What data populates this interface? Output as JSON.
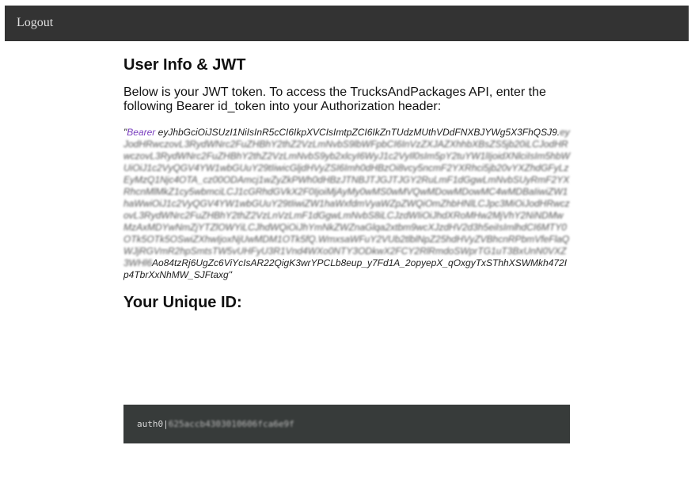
{
  "nav": {
    "logout_label": "Logout"
  },
  "main": {
    "title": "User Info & JWT",
    "intro": "Below is your JWT token. To access the TrucksAndPackages API, enter the following Bearer id_token into your Authorization header:",
    "token": {
      "open_quote": "\"",
      "bearer": "Bearer",
      "first_line": "eyJhbGciOiJSUzI1NiIsInR5cCI6IkpXVCIsImtpZCI6IkZnTUdzMUthVDdFNXBJYWg5X3FhQSJ9.",
      "obscured": "eyJodHRwczovL3RydWNrc2FuZHBhY2thZ2VzLmNvbS9lbWFpbCI6InVzZXJAZXhhbXBsZS5jb20iLCJodHRwczovL3RydWNrc2FuZHBhY2thZ2VzLmNvbS9yb2xlcyI6WyJ1c2VyIl0sIm5pY2tuYW1lIjoidXNlciIsIm5hbWUiOiJ1c2VyQGV4YW1wbGUuY29tIiwicGljdHVyZSI6Imh0dHBzOi8vcy5ncmF2YXRhci5jb20vYXZhdGFyLzEyMzQ1Njc4OTA_cz00ODAmcj1wZyZkPWh0dHBzJTNBJTJGJTJGY2RuLmF1dGgwLmNvbSUyRmF2YXRhcnMlMkZ1cy5wbmciLCJ1cGRhdGVkX2F0IjoiMjAyMy0wMS0wMVQwMDowMDowMC4wMDBaIiwiZW1haWwiOiJ1c2VyQGV4YW1wbGUuY29tIiwiZW1haWxfdmVyaWZpZWQiOmZhbHNlLCJpc3MiOiJodHRwczovL3RydWNrc2FuZHBhY2thZ2VzLnVzLmF1dGgwLmNvbS8iLCJzdWIiOiJhdXRoMHw2MjVhY2NiNDMwMzAxMDYwNmZjYTZlOWYiLCJhdWQiOiJhYmNkZWZnaGlqa2xtbm9wcXJzdHV2d3h5eiIsImlhdCI6MTY0OTk5OTk5OSwiZXhwIjoxNjUwMDM1OTk5fQ.WmxsaWFuY2VUb2tlblNpZ25hdHVyZVBhcnRPbmVfeFlaQWJjRGVmR2hpSmtsTW5vUHFyU3R1Vnd4WXo0NTY3ODkwX2FCY2RlRmdoSWprTG1uT3BxUnN0VXZ3WHl6",
      "last_line": "Ao84tzRj6UgZc6ViYcIsAR22QigK3wrYPCLb8eup_y7Fd1A_2opyepX_qOxgyTxSThhXSWMkh472Ip4TbrXxNhMW_SJFtaxg",
      "close_quote": "\""
    },
    "uid_title": "Your Unique ID:",
    "uid": {
      "prefix": "auth0|",
      "value": "625accb4303010606fca6e9f"
    }
  },
  "colors": {
    "navbar_bg": "#333333",
    "id_box_bg": "#373b3a",
    "bearer_text": "#7a3fbf"
  }
}
